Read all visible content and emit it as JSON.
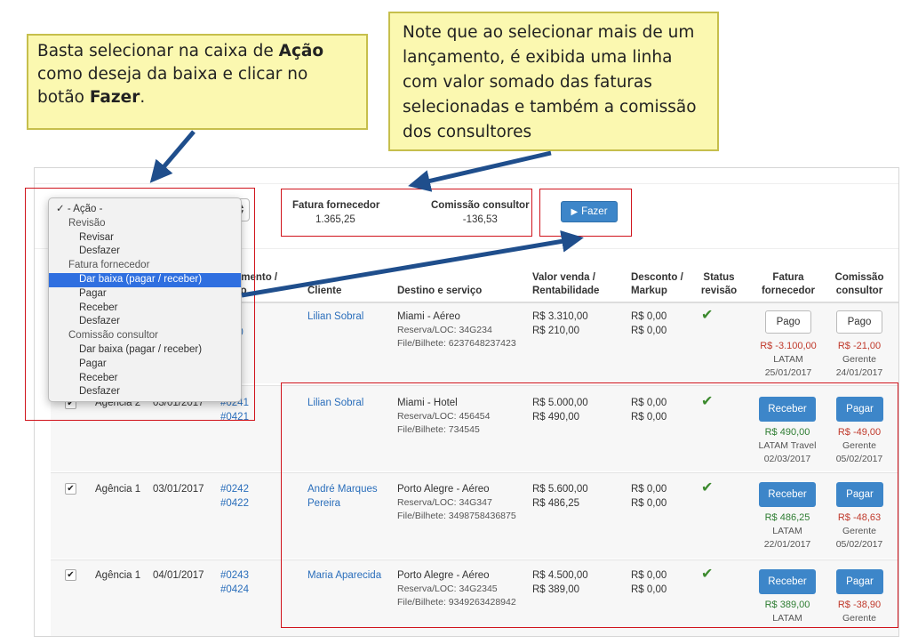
{
  "callouts": {
    "left": {
      "p1": "Basta selecionar na caixa de ",
      "b1": "Ação",
      "p2": " como deseja da baixa e clicar no botão ",
      "b2": "Fazer",
      "p3": "."
    },
    "right": {
      "text": "Note que ao selecionar mais de um lançamento, é exibida uma linha com valor somado das faturas selecionadas e também a comissão dos consultores"
    }
  },
  "toolbar": {
    "fatura_label": "Fatura fornecedor",
    "fatura_value": "1.365,25",
    "comissao_label": "Comissão consultor",
    "comissao_value": "-136,53",
    "fazer_label": "Fazer"
  },
  "action_dropdown": {
    "selected": "- Ação -",
    "items": [
      {
        "label": "- Ação -",
        "level": "lvl0",
        "checked": true
      },
      {
        "label": "Revisão",
        "level": "grp"
      },
      {
        "label": "Revisar",
        "level": "opt"
      },
      {
        "label": "Desfazer",
        "level": "opt"
      },
      {
        "label": "Fatura fornecedor",
        "level": "grp"
      },
      {
        "label": "Dar baixa (pagar / receber)",
        "level": "opt",
        "highlighted": true
      },
      {
        "label": "Pagar",
        "level": "opt"
      },
      {
        "label": "Receber",
        "level": "opt"
      },
      {
        "label": "Desfazer",
        "level": "opt"
      },
      {
        "label": "Comissão consultor",
        "level": "grp"
      },
      {
        "label": "Dar baixa (pagar / receber)",
        "level": "opt"
      },
      {
        "label": "Pagar",
        "level": "opt"
      },
      {
        "label": "Receber",
        "level": "opt"
      },
      {
        "label": "Desfazer",
        "level": "opt"
      }
    ]
  },
  "table": {
    "headers": {
      "atendimento_a": "dimento /",
      "atendimento_b": "iço",
      "cliente": "Cliente",
      "destino": "Destino e serviço",
      "valor_a": "Valor venda /",
      "valor_b": "Rentabilidade",
      "desconto_a": "Desconto /",
      "desconto_b": "Markup",
      "status_a": "Status",
      "status_b": "revisão",
      "fatura_a": "Fatura",
      "fatura_b": "fornecedor",
      "comissao_a": "Comissão",
      "comissao_b": "consultor"
    },
    "rows": [
      {
        "agencia": "",
        "data": "",
        "num_a": "1",
        "num_b": "20",
        "cliente_a": "Lilian Sobral",
        "cliente_b": "",
        "destino": "Miami - Aéreo",
        "loc": "Reserva/LOC: 34G234",
        "bilhete": "File/Bilhete: 6237648237423",
        "valor": "R$ 3.310,00",
        "rent": "R$ 210,00",
        "desconto": "R$ 0,00",
        "markup": "R$ 0,00",
        "fatura_btn": "Pago",
        "fatura_amt": "R$ -3.100,00",
        "fatura_who": "LATAM",
        "fatura_date": "25/01/2017",
        "com_btn": "Pago",
        "com_amt": "R$ -21,00",
        "com_who": "Gerente",
        "com_date": "24/01/2017"
      },
      {
        "agencia": "Agência 2",
        "data": "03/01/2017",
        "num_a": "#0241",
        "num_b": "#0421",
        "cliente_a": "Lilian Sobral",
        "cliente_b": "",
        "destino": "Miami - Hotel",
        "loc": "Reserva/LOC: 456454",
        "bilhete": "File/Bilhete: 734545",
        "valor": "R$ 5.000,00",
        "rent": "R$ 490,00",
        "desconto": "R$ 0,00",
        "markup": "R$ 0,00",
        "fatura_btn": "Receber",
        "fatura_amt": "R$ 490,00",
        "fatura_who": "LATAM Travel",
        "fatura_date": "02/03/2017",
        "com_btn": "Pagar",
        "com_amt": "R$ -49,00",
        "com_who": "Gerente",
        "com_date": "05/02/2017"
      },
      {
        "agencia": "Agência 1",
        "data": "03/01/2017",
        "num_a": "#0242",
        "num_b": "#0422",
        "cliente_a": "André Marques",
        "cliente_b": "Pereira",
        "destino": "Porto Alegre - Aéreo",
        "loc": "Reserva/LOC: 34G347",
        "bilhete": "File/Bilhete: 3498758436875",
        "valor": "R$ 5.600,00",
        "rent": "R$ 486,25",
        "desconto": "R$ 0,00",
        "markup": "R$ 0,00",
        "fatura_btn": "Receber",
        "fatura_amt": "R$ 486,25",
        "fatura_who": "LATAM",
        "fatura_date": "22/01/2017",
        "com_btn": "Pagar",
        "com_amt": "R$ -48,63",
        "com_who": "Gerente",
        "com_date": "05/02/2017"
      },
      {
        "agencia": "Agência 1",
        "data": "04/01/2017",
        "num_a": "#0243",
        "num_b": "#0424",
        "cliente_a": "Maria Aparecida",
        "cliente_b": "",
        "destino": "Porto Alegre - Aéreo",
        "loc": "Reserva/LOC: 34G2345",
        "bilhete": "File/Bilhete: 9349263428942",
        "valor": "R$ 4.500,00",
        "rent": "R$ 389,00",
        "desconto": "R$ 0,00",
        "markup": "R$ 0,00",
        "fatura_btn": "Receber",
        "fatura_amt": "R$ 389,00",
        "fatura_who": "LATAM",
        "fatura_date": "",
        "com_btn": "Pagar",
        "com_amt": "R$ -38,90",
        "com_who": "Gerente",
        "com_date": ""
      }
    ]
  },
  "colors": {
    "callout_bg": "#fbf8b0",
    "callout_border": "#c6bf4c",
    "arrow": "#1f4e8c",
    "highlight_frame": "#d0141c",
    "primary_button": "#3d86c9",
    "link": "#2a6ebb",
    "negative": "#c0392b",
    "positive": "#2e7d32",
    "dropdown_selected": "#2f6fe0"
  }
}
